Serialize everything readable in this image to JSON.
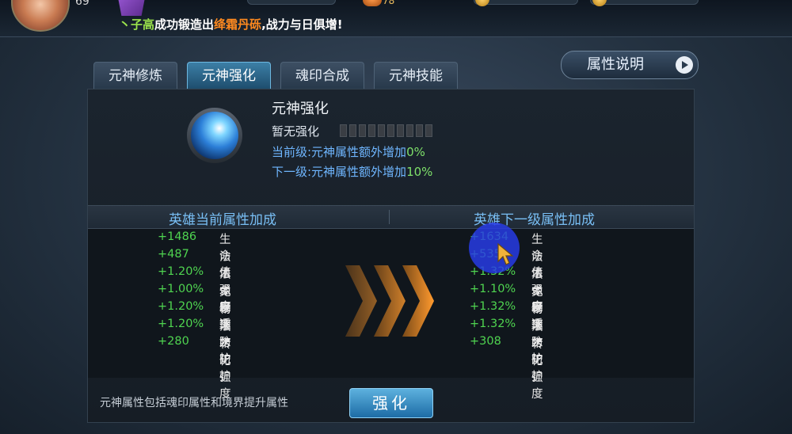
{
  "topbar": {
    "level": "69",
    "resource_value": "78",
    "notice": {
      "prefix": "丶子",
      "name": "高",
      "middle": "成功锻造出",
      "item": "绛霜丹砾",
      "suffix": ",战力与日俱增!"
    }
  },
  "tabs": [
    {
      "label": "元神修炼",
      "active": false
    },
    {
      "label": "元神强化",
      "active": true
    },
    {
      "label": "魂印合成",
      "active": false
    },
    {
      "label": "元神技能",
      "active": false
    }
  ],
  "attr_button": {
    "label": "属性说明"
  },
  "skill": {
    "title": "元神强化",
    "status": "暂无强化",
    "progress_filled": 0,
    "progress_total": 10,
    "current_prefix": "当前级:元神属性额外增加",
    "current_pct": "0%",
    "next_prefix": "下一级:元神属性额外增加",
    "next_pct": "10%"
  },
  "current_header": "英雄当前属性加成",
  "next_header": "英雄下一级属性加成",
  "current_stats": [
    {
      "value": "+1486",
      "label": "生命值"
    },
    {
      "value": "+487",
      "label": "法术强度"
    },
    {
      "value": "+1.20%",
      "label": "法术穿透"
    },
    {
      "value": "+1.00%",
      "label": "免暴率"
    },
    {
      "value": "+1.20%",
      "label": "物理防护"
    },
    {
      "value": "+1.20%",
      "label": "法术防护"
    },
    {
      "value": "+280",
      "label": "转化强度"
    }
  ],
  "next_stats": [
    {
      "value": "+1634",
      "label": "生命值"
    },
    {
      "value": "+535",
      "label": "法术强度"
    },
    {
      "value": "+1.32%",
      "label": "法术穿透"
    },
    {
      "value": "+1.10%",
      "label": "免暴率"
    },
    {
      "value": "+1.32%",
      "label": "物理防护"
    },
    {
      "value": "+1.32%",
      "label": "法术防护"
    },
    {
      "value": "+308",
      "label": "转化强度"
    }
  ],
  "footer_note": "元神属性包括魂印属性和境界提升属性",
  "upgrade_button": "强化",
  "colors": {
    "accent_blue": "#79bff5",
    "stat_green": "#4fd450",
    "tab_active": "#2a6e96"
  }
}
